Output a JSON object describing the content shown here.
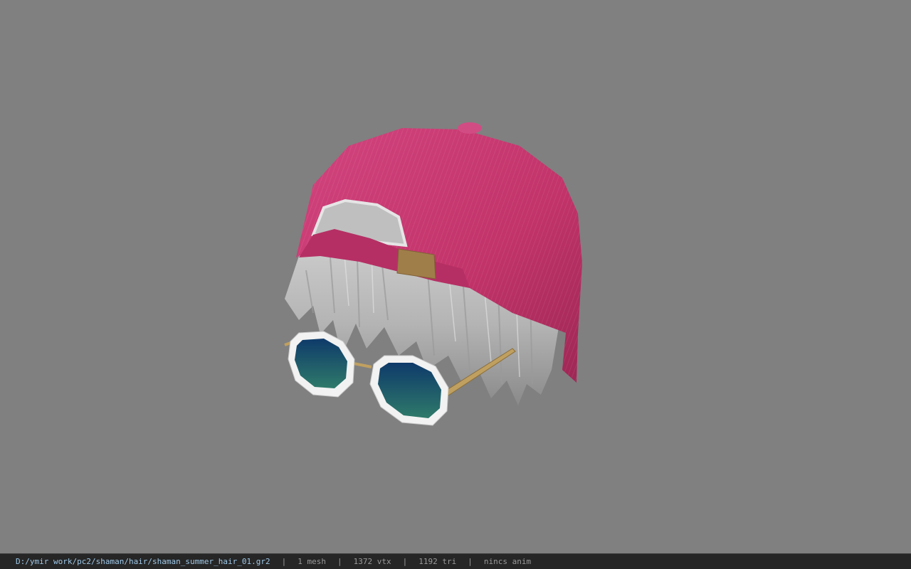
{
  "viewport": {
    "background": "#808080",
    "model": {
      "description_icons": [
        "cap-icon",
        "hair-icon",
        "sunglasses-icon"
      ],
      "colors": {
        "cap": "#c8336f",
        "cap_strap": "#b0305f",
        "buckle": "#a07e4a",
        "hair": "#bdbdbd",
        "lens": "#1a4f5a",
        "frame": "#f2f2f2",
        "temple": "#b89858"
      }
    }
  },
  "status_bar": {
    "file_path": "D:/ymir work/pc2/shaman/hair/shaman_summer_hair_01.gr2",
    "separator": "|",
    "mesh_count": "1 mesh",
    "vertex_count": "1372 vtx",
    "triangle_count": "1192 tri",
    "anim_info": "nincs anim"
  }
}
